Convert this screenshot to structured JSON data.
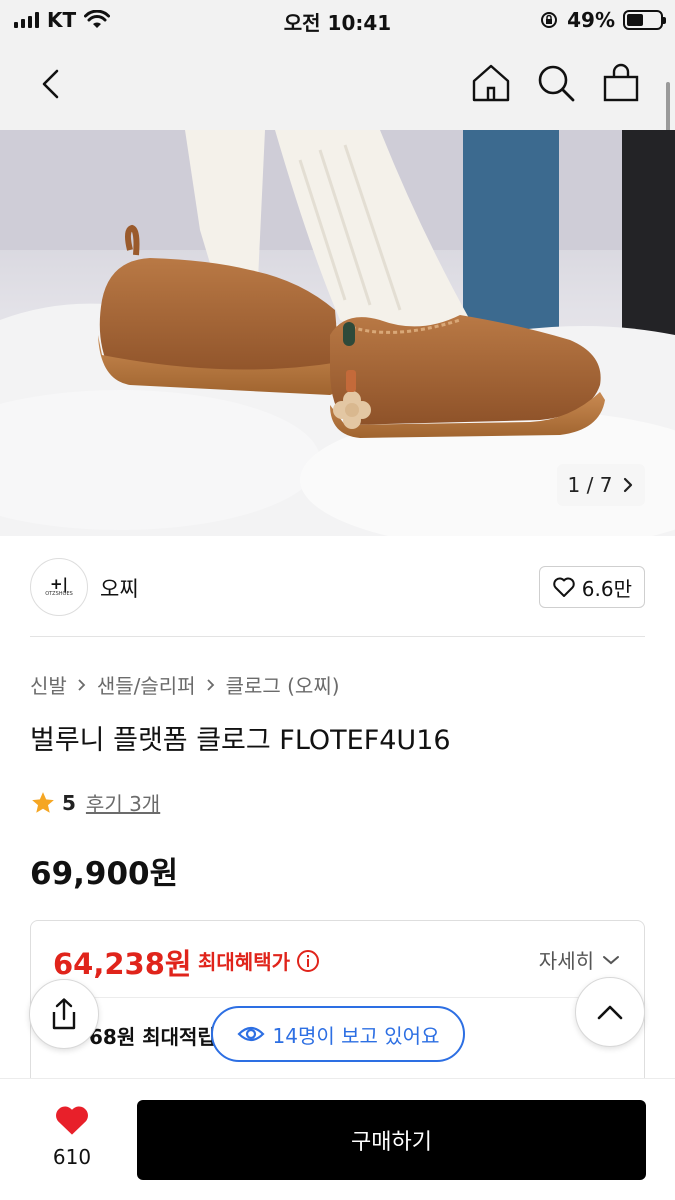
{
  "status_bar": {
    "carrier": "KT",
    "time": "오전 10:41",
    "battery": "49%",
    "battery_level": 0.49
  },
  "nav": {
    "icons": [
      "back-icon",
      "home-icon",
      "search-icon",
      "shopping-bag-icon"
    ]
  },
  "gallery": {
    "counter": "1 / 7",
    "current": 1,
    "total": 7
  },
  "brand": {
    "logo_text_main": "+|",
    "logo_text_sub": "OTZSHOES",
    "name": "오찌",
    "likes": "6.6만"
  },
  "breadcrumb": [
    "신발",
    "샌들/슬리퍼",
    "클로그 (오찌)"
  ],
  "product": {
    "title": "벌루니 플랫폼 클로그 FLOTEF4U16",
    "rating": "5",
    "reviews": "후기 3개",
    "price": "69,900원"
  },
  "benefit": {
    "price": "64,238원",
    "label": "최대혜택가",
    "detail": "자세히",
    "points_text": "68원 최대적립"
  },
  "viewers": "14명이 보고 있어요",
  "bottom": {
    "wish_count": "610",
    "buy_label": "구매하기"
  },
  "colors": {
    "accent_red": "#e0241b",
    "accent_blue": "#2d6fe3",
    "heart_red": "#e8202a",
    "star": "#f5a623"
  }
}
